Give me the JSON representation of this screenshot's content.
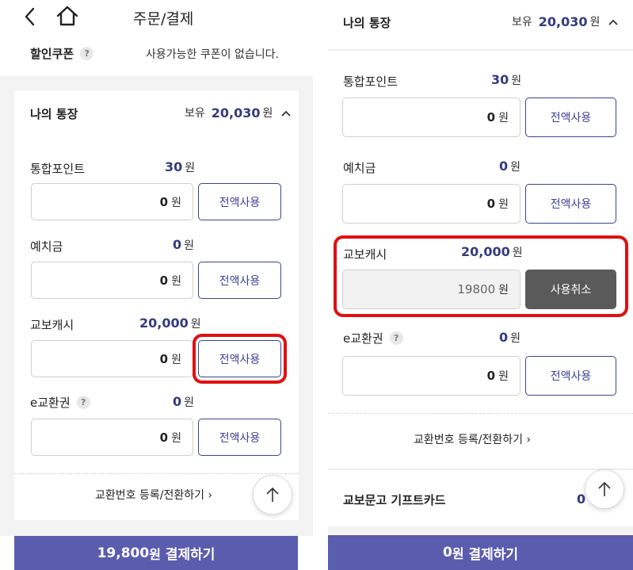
{
  "left": {
    "header_title": "주문/결제",
    "coupon": {
      "label": "할인쿠폰",
      "help": "?",
      "text": "사용가능한 쿠폰이 없습니다."
    },
    "wallet": {
      "title": "나의 통장",
      "held_label": "보유",
      "held_amount": "20,030",
      "unit": "원"
    },
    "rows": [
      {
        "label": "통합포인트",
        "amount": "30",
        "unit": "원",
        "input": "0",
        "input_unit": "원",
        "button": "전액사용"
      },
      {
        "label": "예치금",
        "amount": "0",
        "unit": "원",
        "input": "0",
        "input_unit": "원",
        "button": "전액사용"
      },
      {
        "label": "교보캐시",
        "amount": "20,000",
        "unit": "원",
        "input": "0",
        "input_unit": "원",
        "button": "전액사용"
      },
      {
        "label": "e교환권",
        "help": "?",
        "amount": "0",
        "unit": "원",
        "input": "0",
        "input_unit": "원",
        "button": "전액사용"
      }
    ],
    "exchange_link": "교환번호 등록/전환하기",
    "pay": {
      "amount": "19,800",
      "unit": "원",
      "label": "결제하기"
    }
  },
  "right": {
    "wallet": {
      "title": "나의 통장",
      "held_label": "보유",
      "held_amount": "20,030",
      "unit": "원"
    },
    "rows": [
      {
        "label": "통합포인트",
        "amount": "30",
        "unit": "원",
        "input": "0",
        "input_unit": "원",
        "button": "전액사용"
      },
      {
        "label": "예치금",
        "amount": "0",
        "unit": "원",
        "input": "0",
        "input_unit": "원",
        "button": "전액사용"
      },
      {
        "label": "교보캐시",
        "amount": "20,000",
        "unit": "원",
        "input": "19800",
        "input_unit": "원",
        "button": "사용취소"
      },
      {
        "label": "e교환권",
        "help": "?",
        "amount": "0",
        "unit": "원",
        "input": "0",
        "input_unit": "원",
        "button": "전액사용"
      }
    ],
    "exchange_link": "교환번호 등록/전환하기",
    "giftcard": {
      "label": "교보문고 기프트카드",
      "amount": "0"
    },
    "pay": {
      "amount": "0",
      "unit": "원",
      "label": "결제하기"
    }
  },
  "colors": {
    "accent": "#343a80",
    "pay_bar": "#5a5cad",
    "highlight": "#e01010",
    "cancel_button": "#5a5a5a"
  }
}
